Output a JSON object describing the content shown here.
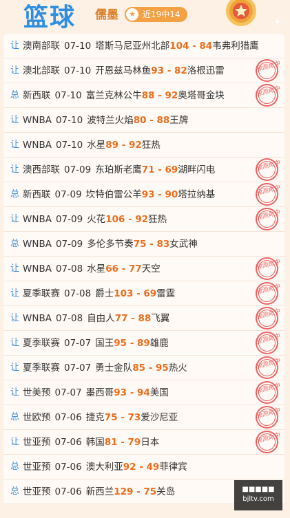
{
  "header": {
    "title": "篮球",
    "author": "儒墨",
    "badge": "近19中14",
    "badge_icon": "star-icon",
    "colors": {
      "title": "#2e8fe0",
      "badge": "#f4a043",
      "score": "#ee6d1b",
      "stamp": "#e84c4c"
    }
  },
  "rows": [
    {
      "tag": "让",
      "league": "澳南部联",
      "date": "07-10",
      "home": "塔斯马尼亚州北部",
      "score": "104 - 84",
      "away": "韦弗利猎鹰",
      "hit": false
    },
    {
      "tag": "让",
      "league": "澳北部联",
      "date": "07-10",
      "home": "开恩兹马林鱼",
      "score": "93 - 82",
      "away": "洛根迅雷",
      "hit": true
    },
    {
      "tag": "总",
      "league": "新西联",
      "date": "07-10",
      "home": "富兰克林公牛",
      "score": "88 - 92",
      "away": "奥塔哥金块",
      "hit": true
    },
    {
      "tag": "让",
      "league": "WNBA",
      "date": "07-10",
      "home": "波特兰火焰",
      "score": "80 - 88",
      "away": "王牌",
      "hit": false
    },
    {
      "tag": "让",
      "league": "WNBA",
      "date": "07-10",
      "home": "水星",
      "score": "89 - 92",
      "away": "狂热",
      "hit": false
    },
    {
      "tag": "让",
      "league": "澳西部联",
      "date": "07-09",
      "home": "东珀斯老鹰",
      "score": "71 - 69",
      "away": "湖畔闪电",
      "hit": true
    },
    {
      "tag": "总",
      "league": "新西联",
      "date": "07-09",
      "home": "坎特伯雷公羊",
      "score": "93 - 90",
      "away": "塔拉纳基",
      "hit": true
    },
    {
      "tag": "让",
      "league": "WNBA",
      "date": "07-09",
      "home": "火花",
      "score": "106 - 92",
      "away": "狂热",
      "hit": true
    },
    {
      "tag": "总",
      "league": "WNBA",
      "date": "07-09",
      "home": "多伦多节奏",
      "score": "75 - 83",
      "away": "女武神",
      "hit": false
    },
    {
      "tag": "让",
      "league": "WNBA",
      "date": "07-08",
      "home": "水星",
      "score": "66 - 77",
      "away": "天空",
      "hit": true
    },
    {
      "tag": "让",
      "league": "夏季联赛",
      "date": "07-08",
      "home": "爵士",
      "score": "103 - 69",
      "away": "雷霆",
      "hit": true
    },
    {
      "tag": "让",
      "league": "WNBA",
      "date": "07-08",
      "home": "自由人",
      "score": "77 - 88",
      "away": "飞翼",
      "hit": true
    },
    {
      "tag": "让",
      "league": "夏季联赛",
      "date": "07-07",
      "home": "国王",
      "score": "95 - 89",
      "away": "雄鹿",
      "hit": true
    },
    {
      "tag": "让",
      "league": "夏季联赛",
      "date": "07-07",
      "home": "勇士金队",
      "score": "85 - 95",
      "away": "热火",
      "hit": true
    },
    {
      "tag": "让",
      "league": "世美预",
      "date": "07-07",
      "home": "墨西哥",
      "score": "93 - 94",
      "away": "美国",
      "hit": true
    },
    {
      "tag": "总",
      "league": "世欧预",
      "date": "07-06",
      "home": "捷克",
      "score": "75 - 73",
      "away": "爱沙尼亚",
      "hit": true
    },
    {
      "tag": "让",
      "league": "世亚预",
      "date": "07-06",
      "home": "韩国",
      "score": "81 - 79",
      "away": "日本",
      "hit": true
    },
    {
      "tag": "总",
      "league": "世亚预",
      "date": "07-06",
      "home": "澳大利亚",
      "score": "92 - 49",
      "away": "菲律宾",
      "hit": false
    },
    {
      "tag": "总",
      "league": "世亚预",
      "date": "07-06",
      "home": "新西兰",
      "score": "129 - 75",
      "away": "关岛",
      "hit": false
    }
  ],
  "stamp_text": "预测命中",
  "watermark": {
    "line1": "■■■■■",
    "line2": "bjltv.com"
  }
}
